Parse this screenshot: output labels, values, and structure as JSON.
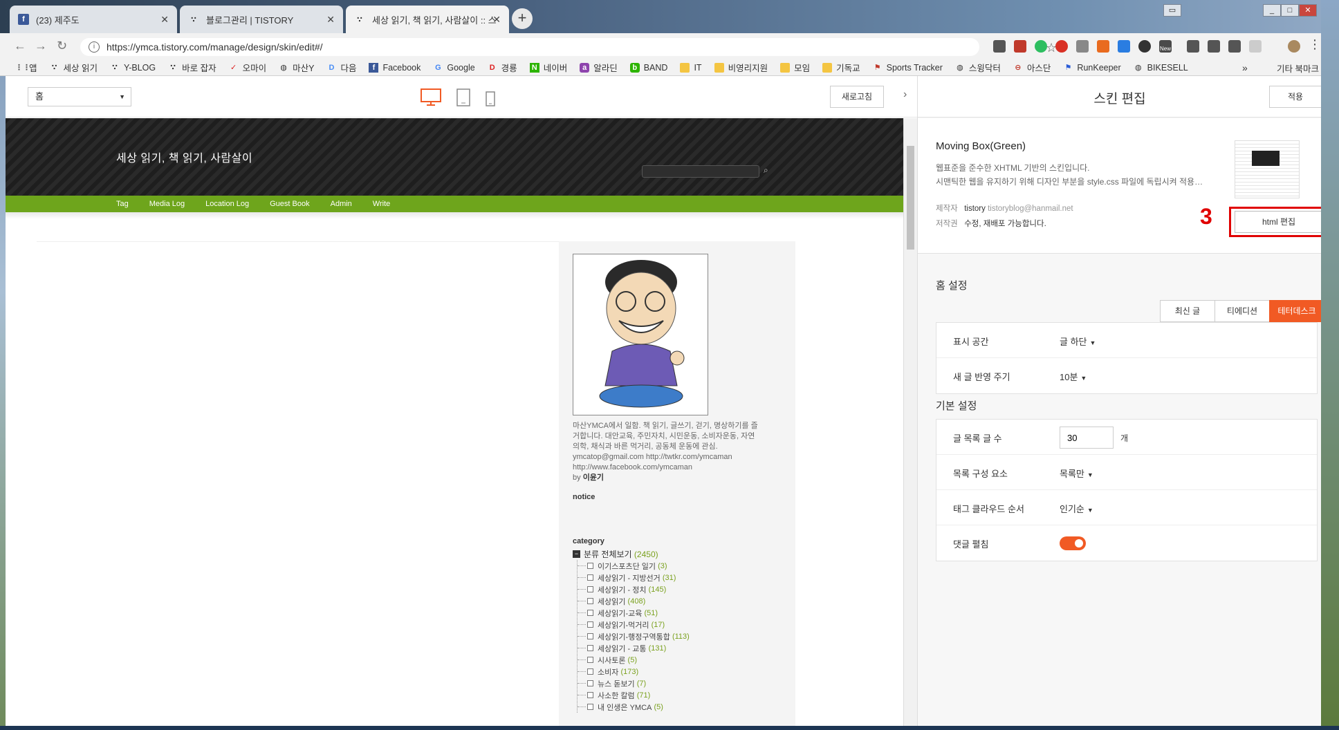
{
  "browser": {
    "tabs": [
      {
        "title": "(23) 제주도",
        "icon": "facebook-icon"
      },
      {
        "title": "블로그관리 | TISTORY",
        "icon": "tistory-icon"
      },
      {
        "title": "세상 읽기, 책 읽기, 사람살이 :: 스",
        "icon": "tistory-icon"
      }
    ],
    "new_tab": "+",
    "url": "https://ymca.tistory.com/manage/design/skin/edit#/",
    "ext_badge": "New",
    "bookmarks": [
      "앱",
      "세상 읽기",
      "Y-BLOG",
      "바로 잡자",
      "오마이",
      "마산Y",
      "다음",
      "Facebook",
      "Google",
      "경룡",
      "네이버",
      "알라딘",
      "BAND",
      "IT",
      "비영리지원",
      "모임",
      "기독교",
      "Sports Tracker",
      "스윙닥터",
      "아스단",
      "RunKeeper",
      "BIKESELL"
    ],
    "bookmarks_more": "»",
    "other_bookmarks": "기타 북마크"
  },
  "preview": {
    "page_select": "홈",
    "refresh": "새로고침",
    "blog": {
      "title": "세상 읽기, 책 읽기, 사람살이",
      "nav": [
        "Tag",
        "Media Log",
        "Location Log",
        "Guest Book",
        "Admin",
        "Write"
      ],
      "profile_lines": [
        "마산YMCA에서 일함. 책 읽기, 글쓰기, 걷기, 명상하기를 즐",
        "거합니다. 대안교육, 주민자치, 시민운동, 소비자운동, 자연",
        "의학, 채식과 바른 먹거리, 공동체 운동에 관심.",
        "ymcatop@gmail.com  http://twtkr.com/ymcaman",
        "http://www.facebook.com/ymcaman"
      ],
      "by_label": "by",
      "by_name": "이윤기",
      "notice": "notice",
      "category": "category",
      "category_total": {
        "name": "분류 전체보기",
        "count": "(2450)"
      },
      "categories": [
        {
          "name": "이기스포츠단 일기",
          "count": "(3)"
        },
        {
          "name": "세상읽기 - 지방선거",
          "count": "(31)"
        },
        {
          "name": "세상읽기 - 정치",
          "count": "(145)"
        },
        {
          "name": "세상읽기",
          "count": "(408)"
        },
        {
          "name": "세상읽기-교육",
          "count": "(51)"
        },
        {
          "name": "세상읽기-먹거리",
          "count": "(17)"
        },
        {
          "name": "세상읽기-행정구역통합",
          "count": "(113)"
        },
        {
          "name": "세상읽기 - 교통",
          "count": "(131)"
        },
        {
          "name": "시사토론",
          "count": "(5)"
        },
        {
          "name": "소비자",
          "count": "(173)"
        },
        {
          "name": "뉴스 돋보기",
          "count": "(7)"
        },
        {
          "name": "사소한 칼럼",
          "count": "(71)"
        },
        {
          "name": "내 인생은 YMCA",
          "count": "(5)"
        }
      ]
    }
  },
  "skin": {
    "title": "스킨 편집",
    "apply": "적용",
    "name": "Moving Box(Green)",
    "desc1": "웹표준을 준수한 XHTML 기반의 스킨입니다.",
    "desc2": "시맨틱한 웹을 유지하기 위해 디자인 부분을 style.css 파일에 독립시켜 적용…",
    "maker_label": "제작자",
    "maker": "tistory",
    "maker_mail": "tistoryblog@hanmail.net",
    "copyright_label": "저작권",
    "copyright": "수정, 재배포 가능합니다.",
    "html_edit": "html 편집",
    "callout": "3",
    "home_settings": {
      "title": "홈 설정",
      "segments": [
        "최신 글",
        "티에디션",
        "테터데스크"
      ],
      "selected": "테터데스크",
      "rows": [
        {
          "label": "표시 공간",
          "value": "글 하단"
        },
        {
          "label": "새 글 반영 주기",
          "value": "10분"
        }
      ]
    },
    "basic_settings": {
      "title": "기본 설정",
      "post_count_label": "글 목록 글 수",
      "post_count": "30",
      "post_count_unit": "개",
      "list_label": "목록 구성 요소",
      "list_value": "목록만",
      "tag_label": "태그 클라우드 순서",
      "tag_value": "인기순",
      "comment_label": "댓글 펼침",
      "comment_on": true
    }
  }
}
